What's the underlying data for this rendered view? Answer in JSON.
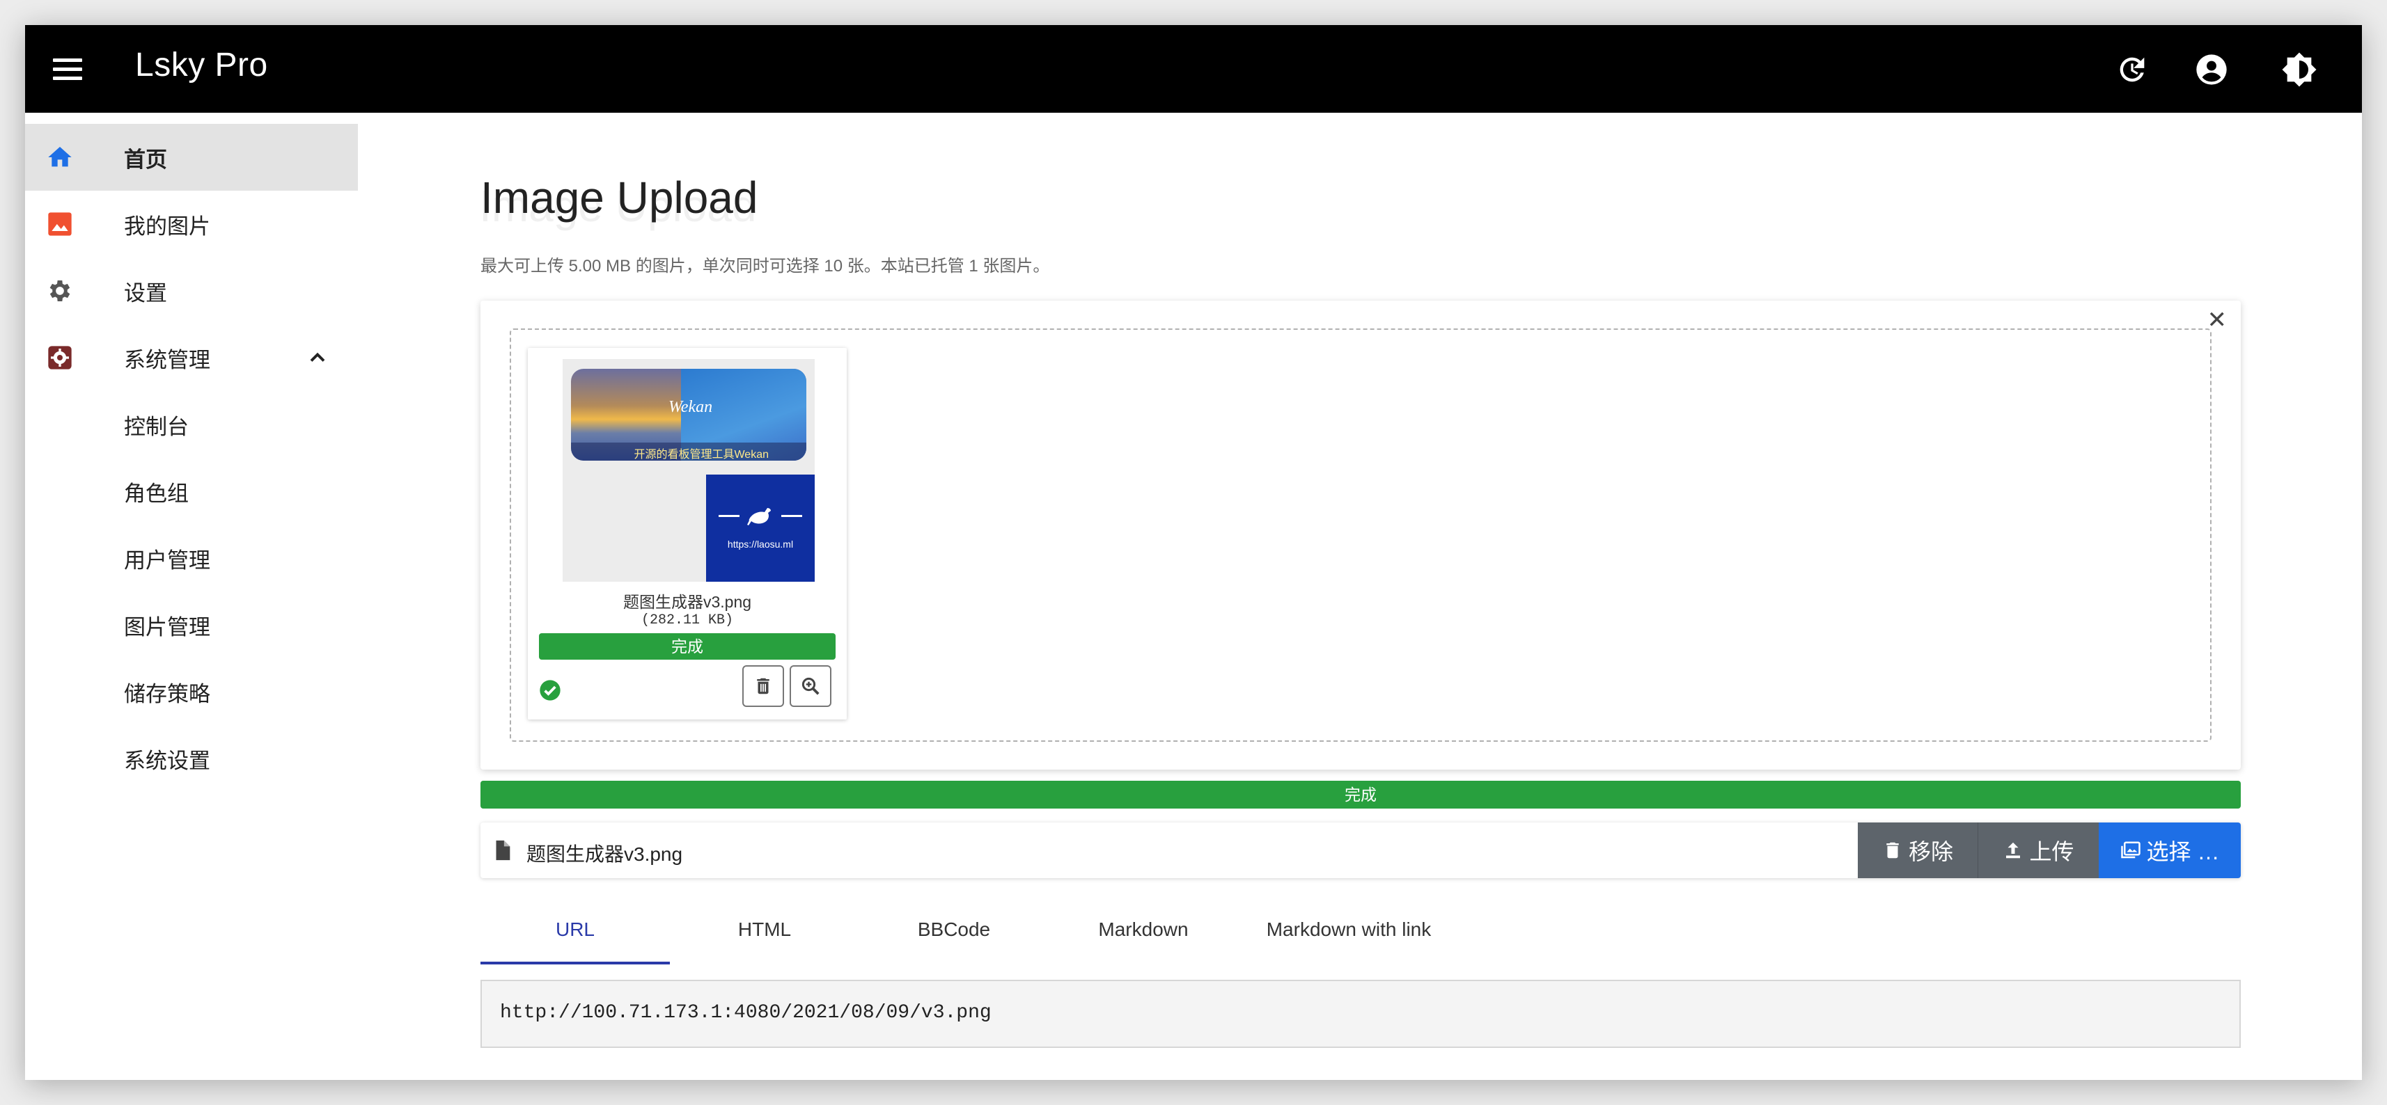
{
  "app": {
    "title": "Lsky Pro"
  },
  "sidebar": {
    "items": [
      {
        "label": "首页",
        "icon": "home-icon",
        "color": "#1e6fe6",
        "active": true
      },
      {
        "label": "我的图片",
        "icon": "image-icon",
        "color": "#f05030"
      },
      {
        "label": "设置",
        "icon": "gear-icon",
        "color": "#555555"
      },
      {
        "label": "系统管理",
        "icon": "admin-gear-icon",
        "color": "#7a2a2a"
      },
      {
        "label": "控制台"
      },
      {
        "label": "角色组"
      },
      {
        "label": "用户管理"
      },
      {
        "label": "图片管理"
      },
      {
        "label": "储存策略"
      },
      {
        "label": "系统设置"
      }
    ]
  },
  "page": {
    "title": "Image Upload",
    "subtitle": "最大可上传 5.00 MB 的图片，单次同时可选择 10 张。本站已托管 1 张图片。"
  },
  "upload": {
    "close": "✕",
    "file": {
      "name": "题图生成器v3.png",
      "size": "(282.11 KB)",
      "status": "完成",
      "progress": 1.0,
      "banner_brand": "Wekan",
      "banner_caption": "开源的看板管理工具Wekan",
      "blue_url": "https://laosu.ml"
    },
    "overall_status": "完成",
    "overall_progress": 1.0,
    "caption": "题图生成器v3.png",
    "buttons": {
      "remove": "移除",
      "upload": "上传",
      "choose": "选择 …"
    }
  },
  "tabs": [
    {
      "label": "URL",
      "active": true
    },
    {
      "label": "HTML"
    },
    {
      "label": "BBCode"
    },
    {
      "label": "Markdown"
    },
    {
      "label": "Markdown with link"
    }
  ],
  "result": {
    "url": "http://100.71.173.1:4080/2021/08/09/v3.png"
  },
  "colors": {
    "appbar": "#000000",
    "success": "#28a03e",
    "primary": "#1e6fe6",
    "secondary": "#5d646b",
    "tab_accent": "#2a3aa8"
  }
}
